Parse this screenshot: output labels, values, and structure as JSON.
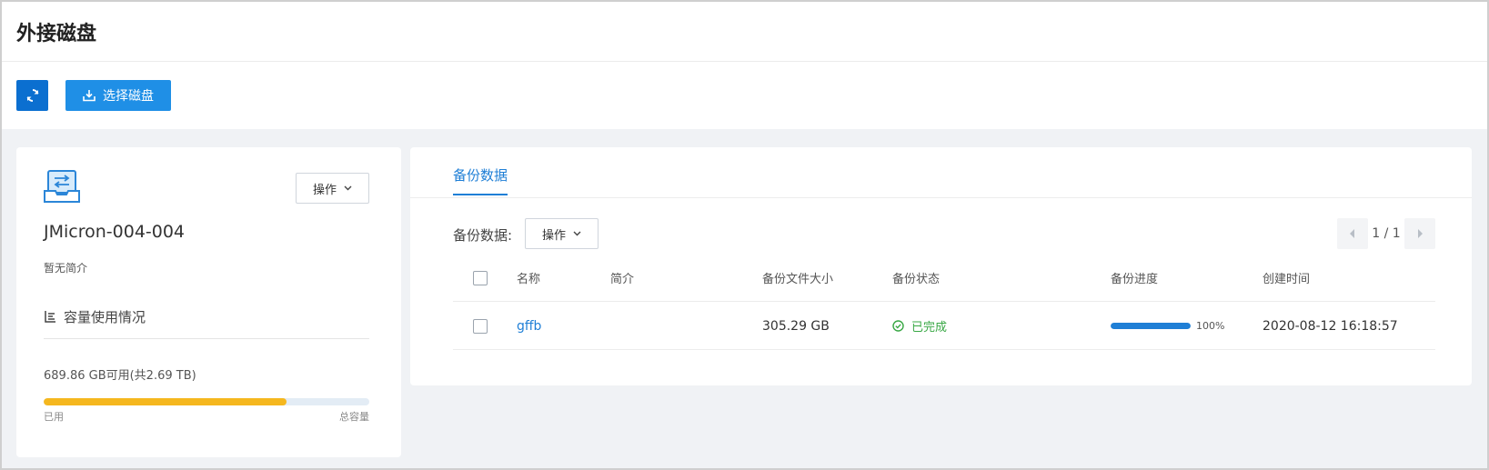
{
  "page": {
    "title": "外接磁盘"
  },
  "toolbar": {
    "refresh_icon": "refresh-icon",
    "select_label": "选择磁盘",
    "select_icon": "download-tray-icon"
  },
  "disk": {
    "icon": "disk-transfer-icon",
    "name": "JMicron-004-004",
    "description": "暂无简介",
    "op_label": "操作",
    "capacity_title": "容量使用情况",
    "capacity_text": "689.86 GB可用(共2.69 TB)",
    "used_fraction": 0.745,
    "used_label": "已用",
    "total_label": "总容量",
    "bar_color": "#f5b71e"
  },
  "backup": {
    "tab_label": "备份数据",
    "filter_label": "备份数据:",
    "op_label": "操作",
    "pager_text": "1 / 1",
    "columns": [
      "名称",
      "简介",
      "备份文件大小",
      "备份状态",
      "备份进度",
      "创建时间"
    ],
    "rows": [
      {
        "name": "gffb",
        "description": "",
        "size": "305.29 GB",
        "status": "已完成",
        "progress_fraction": 1.0,
        "progress_text": "100%",
        "created": "2020-08-12 16:18:57"
      }
    ]
  },
  "colors": {
    "primary": "#1f7fd6",
    "success": "#39a845",
    "capacity": "#f5b71e"
  }
}
